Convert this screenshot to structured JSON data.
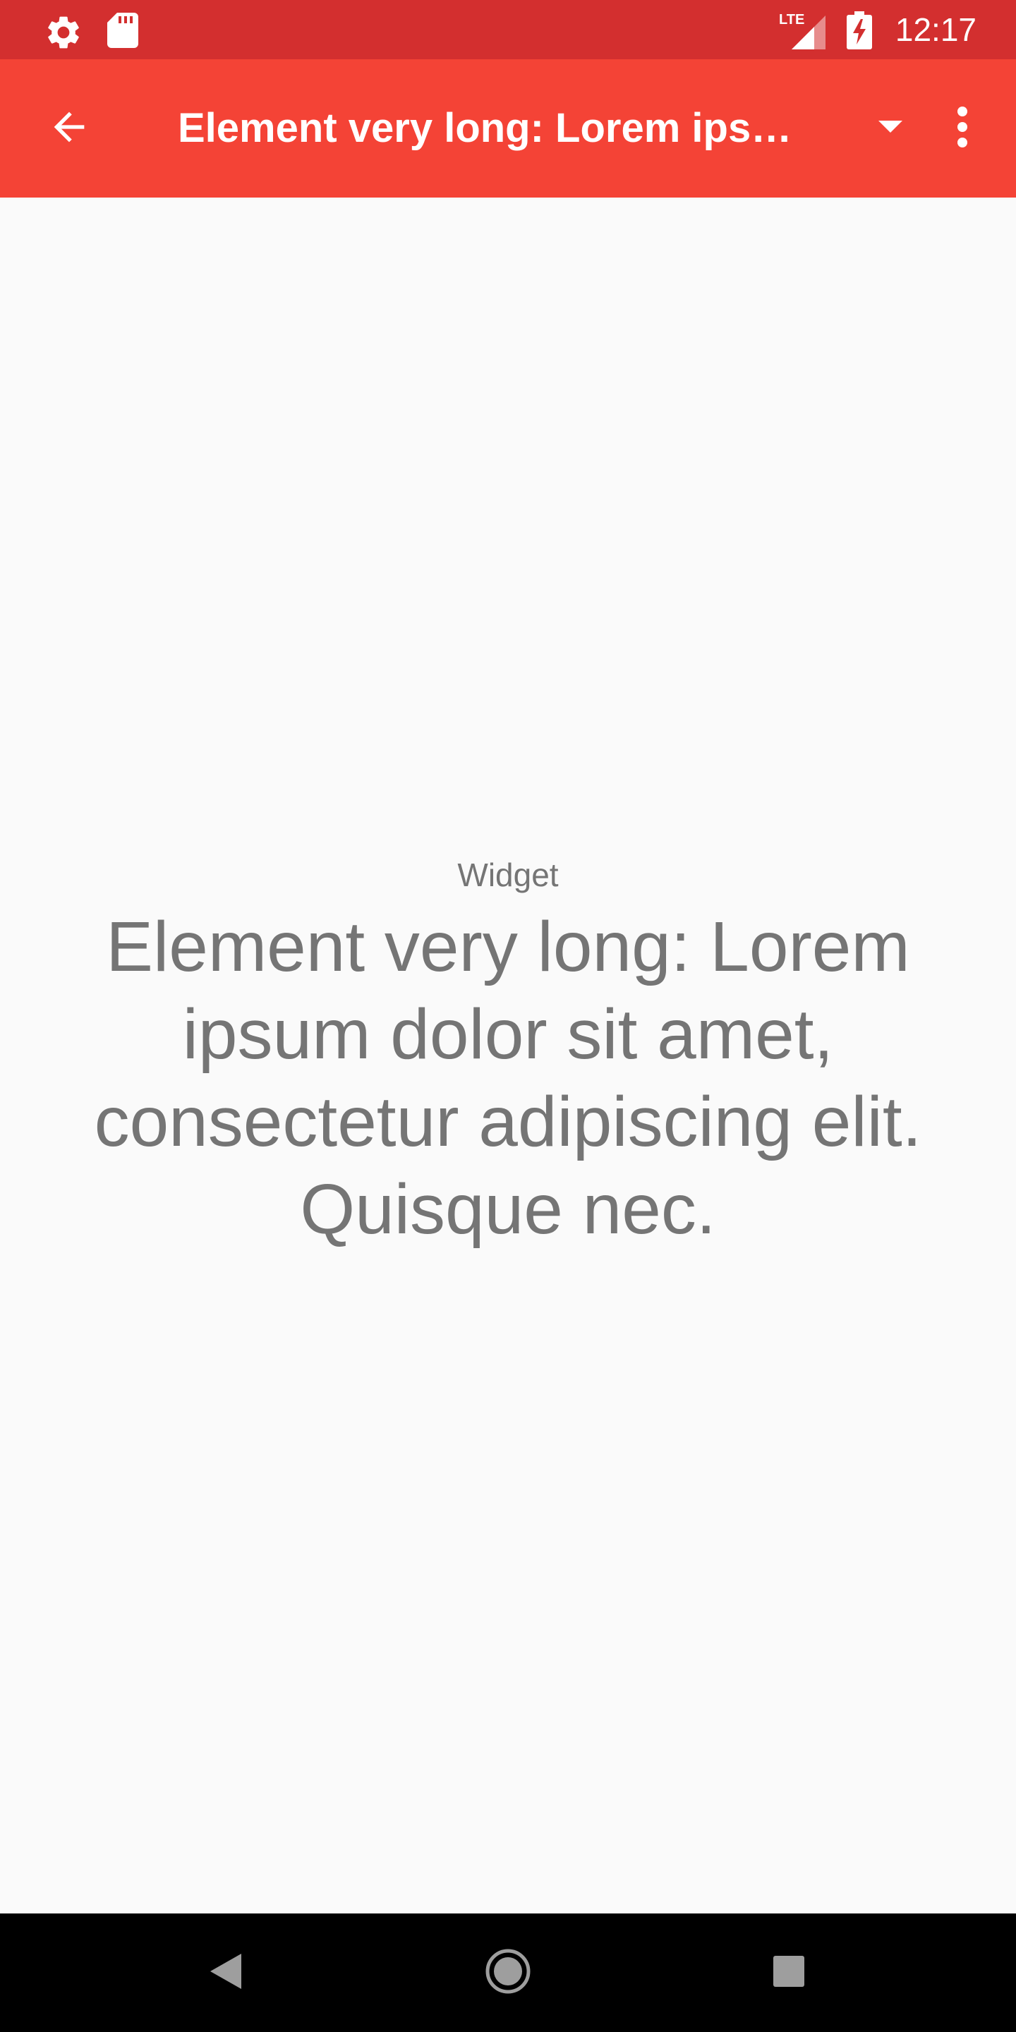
{
  "status_bar": {
    "time": "12:17",
    "network": "LTE",
    "icons": [
      "settings-icon",
      "sd-card-icon",
      "lte-signal-icon",
      "battery-charging-icon"
    ],
    "color": "#d32f2f"
  },
  "app_bar": {
    "title": "Element very long: Lorem ipsum dolor sit amet, consectetur adipiscing elit. Quisque nec.",
    "color": "#f44336",
    "icons": [
      "arrow-back-icon",
      "dropdown-arrow-icon",
      "more-vert-icon"
    ]
  },
  "widget": {
    "label": "Widget",
    "value": "Element very long: Lorem ipsum dolor sit amet, consectetur adipiscing elit. Quisque nec.",
    "text_color": "#757575"
  },
  "nav_bar": {
    "icons": [
      "nav-back-icon",
      "nav-home-icon",
      "nav-recents-icon"
    ],
    "icon_color": "#9e9e9e"
  }
}
